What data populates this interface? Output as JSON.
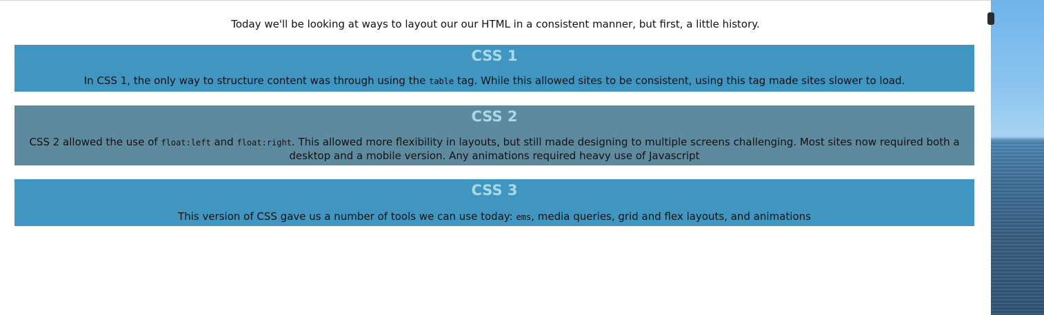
{
  "intro": "Today we'll be looking at ways to layout our our HTML in a consistent manner, but first, a little history.",
  "sections": [
    {
      "heading": "CSS 1",
      "text_before_code": "In CSS 1, the only way to structure content was through using the ",
      "code": "table",
      "text_after_code": " tag. While this allowed sites to be consistent, using this tag made sites slower to load."
    },
    {
      "heading": "CSS 2",
      "text_before_code": "CSS 2 allowed the use of ",
      "code": "float:left",
      "text_between_code": " and ",
      "code2": "float:right",
      "text_after_code": ". This allowed more flexibility in layouts, but still made designing to multiple screens challenging. Most sites now required both a desktop and a mobile version. Any animations required heavy use of Javascript"
    },
    {
      "heading": "CSS 3",
      "text_before_code": "This version of CSS gave us a number of tools we can use today: ",
      "code": "ems",
      "text_after_code": ", media queries, grid and flex layouts, and animations"
    }
  ],
  "colors": {
    "section_blue": "#4096c0",
    "section_slate": "#5e8aa0",
    "heading_color": "#a9d9e6",
    "text_color": "#111111"
  }
}
